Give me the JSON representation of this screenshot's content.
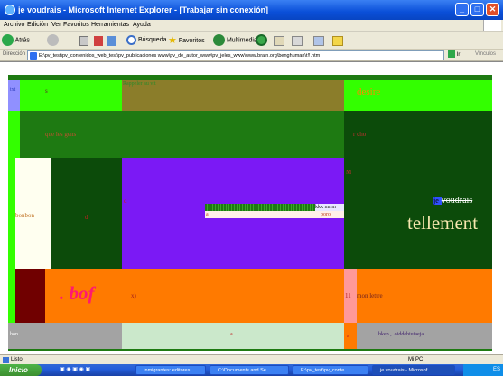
{
  "window": {
    "title": "je voudrais - Microsoft Internet Explorer - [Trabajar sin conexión]",
    "minimize": "_",
    "maximize": "□",
    "close": "✕"
  },
  "menu": [
    "Archivo",
    "Edición",
    "Ver",
    "Favoritos",
    "Herramientas",
    "Ayuda"
  ],
  "toolbar": {
    "back": "Atrás",
    "search": "Búsqueda",
    "favorites": "Favoritos",
    "media": "Multimedia"
  },
  "address": {
    "label": "Dirección",
    "url": "E:\\pv_test\\pv_contenidos_web_test\\pv_publicaciones www\\pv_de_autor_www\\pv_jeles_www\\www.brain.org\\benghuman\\t!!.htm",
    "go": "Ir",
    "links": "Vínculos"
  },
  "page": {
    "r1_left": "txt",
    "r1_mid": "s",
    "r1_green": "Rappeler au vit",
    "r1_right": "desire",
    "r2_mid": "que les gens",
    "r2_right": "r cho",
    "r3_left": "bonbon",
    "r3_mid": "d",
    "r3_purple": "d",
    "r3_right_top": "M",
    "r3_kkk": "kkk mmn",
    "r3_poro": "poro",
    "r3_poro_mark": "a",
    "r3_je": "je ",
    "r3_voudrais": "voudrais",
    "r3_tellement": "tellement",
    "r4_bof": ". bof",
    "r4_mid": "x)",
    "r4_pink": "11",
    "r4_right": "mon lettre",
    "r5_left": "bon",
    "r5_mid": "a",
    "r5_orange": "a",
    "r5_right": "hkep.,..oiddebiuiaeja"
  },
  "status": {
    "text": "Listo",
    "zone": "Mi PC"
  },
  "taskbar": {
    "start": "Inicio",
    "tasks": [
      "Inmigrantes: editores ...",
      "C:\\Documents and Se...",
      "E:\\pv_test\\pv_conte...",
      "je voudrais - Microsof..."
    ],
    "clock": "ES"
  },
  "colors": {
    "frame_green": "#1e7a12",
    "bright_green": "#33ff00",
    "olive": "#8b7d2a",
    "dark_green": "#0c4b0a",
    "purple": "#7b19f5",
    "orange": "#ff7a00",
    "maroon": "#700000",
    "pink": "#ff9999",
    "gray": "#a3a3a3"
  }
}
